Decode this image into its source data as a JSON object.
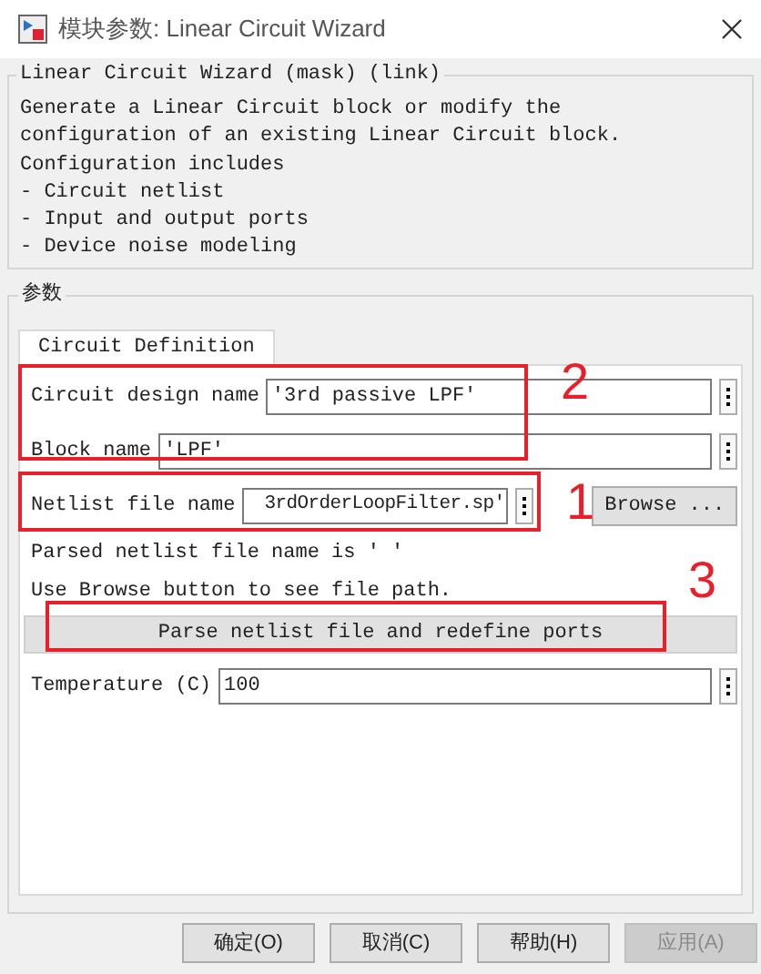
{
  "window": {
    "title": "模块参数: Linear Circuit Wizard"
  },
  "description": {
    "title": "Linear Circuit Wizard (mask) (link)",
    "lines": [
      "Generate a Linear Circuit block or modify the",
      "configuration of an existing Linear Circuit block.",
      "Configuration includes",
      "- Circuit netlist",
      "- Input and output ports",
      "- Device noise modeling"
    ]
  },
  "parameters": {
    "title": "参数",
    "tabs": [
      {
        "label": "Circuit Definition",
        "selected": true
      }
    ],
    "fields": [
      {
        "label": "Circuit design name",
        "value": "'3rd passive LPF'"
      },
      {
        "label": "Block name",
        "value": "'LPF'"
      },
      {
        "label": "Netlist file name",
        "value": "3rdOrderLoopFilter.sp'",
        "browse": "Browse ..."
      }
    ],
    "notes": [
      "Parsed netlist file name is ' '",
      "Use Browse button to see file path."
    ],
    "parse_button": "Parse netlist file and redefine ports",
    "temperature": {
      "label": "Temperature (C)",
      "value": "100"
    }
  },
  "annotations": [
    {
      "label": "2"
    },
    {
      "label": "1"
    },
    {
      "label": "3"
    }
  ],
  "buttons": [
    {
      "label": "确定(O)",
      "disabled": false
    },
    {
      "label": "取消(C)",
      "disabled": false
    },
    {
      "label": "帮助(H)",
      "disabled": false
    },
    {
      "label": "应用(A)",
      "disabled": true
    }
  ]
}
